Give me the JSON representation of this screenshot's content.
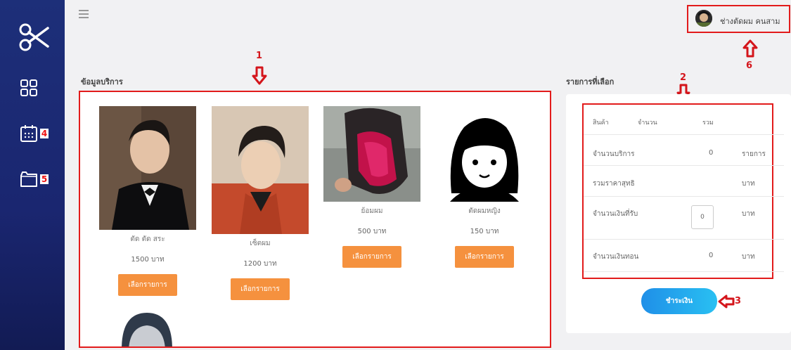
{
  "sidebar": {
    "logo_icon": "scissors-icon",
    "items": [
      {
        "icon": "grid-icon",
        "annotation": ""
      },
      {
        "icon": "calendar-icon",
        "annotation": "4"
      },
      {
        "icon": "folder-icon",
        "annotation": "5"
      }
    ],
    "background": "#1d2f79"
  },
  "header": {
    "menu_icon": "hamburger-icon",
    "user_name": "ช่างตัดผม คนสาม",
    "annotation": "6"
  },
  "services": {
    "title": "ข้อมูลบริการ",
    "annotation": "1",
    "button_label": "เลือกรายการ",
    "items": [
      {
        "name": "ตัด ตัด สระ",
        "price": "1500 บาท"
      },
      {
        "name": "เซ็ตผม",
        "price": "1200 บาท"
      },
      {
        "name": "ย้อมผม",
        "price": "500 บาท"
      },
      {
        "name": "ตัดผมหญิง",
        "price": "150 บาท"
      }
    ]
  },
  "summary": {
    "title": "รายการที่เลือก",
    "annotation": "2",
    "headers": {
      "product": "สินค้า",
      "quantity": "จำนวน",
      "total": "รวม"
    },
    "rows": {
      "service_count": {
        "label": "จำนวนบริการ",
        "value": "0",
        "unit": "รายการ"
      },
      "net_total": {
        "label": "รวมราคาสุทธิ",
        "unit": "บาท"
      },
      "received": {
        "label": "จำนวนเงินที่รับ",
        "value": "0",
        "unit": "บาท"
      },
      "change": {
        "label": "จำนวนเงินทอน",
        "value": "0",
        "unit": "บาท"
      }
    },
    "pay_label": "ชำระเงิน",
    "pay_annotation": "3"
  },
  "colors": {
    "accent": "#f5913e",
    "annotation": "#d4151b",
    "pay": "#1f8fe8"
  }
}
